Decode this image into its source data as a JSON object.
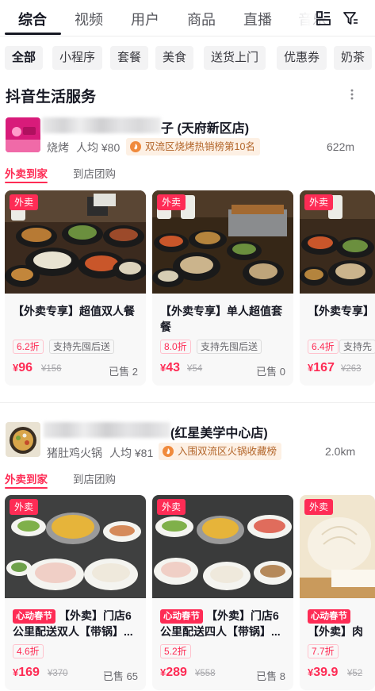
{
  "top_tabs": [
    "综合",
    "视频",
    "用户",
    "商品",
    "直播",
    "音乐"
  ],
  "top_icons": [
    "layout-icon",
    "filter-icon"
  ],
  "filter_chips": [
    "全部",
    "小程序",
    "套餐",
    "美食",
    "送货上门",
    "优惠券",
    "奶茶"
  ],
  "section_title": "抖音生活服务",
  "store1": {
    "name_suffix": "子 (天府新区店)",
    "category": "烧烤",
    "avg_price": "人均 ¥80",
    "rank": "双流区烧烤热销榜第10名",
    "distance": "622m",
    "tab_delivery": "外卖到家",
    "tab_groupbuy": "到店团购",
    "products": [
      {
        "tag": "外卖",
        "title": "【外卖专享】超值双人餐",
        "discount": "6.2折",
        "feature": "支持先囤后送",
        "price": "96",
        "orig": "¥156",
        "sold": "已售 2"
      },
      {
        "tag": "外卖",
        "title": "【外卖专享】单人超值套餐",
        "discount": "8.0折",
        "feature": "支持先囤后送",
        "price": "43",
        "orig": "¥54",
        "sold": "已售 0"
      },
      {
        "tag": "外卖",
        "title": "【外卖专享】",
        "discount": "6.4折",
        "feature": "支持先",
        "price": "167",
        "orig": "¥263",
        "sold": ""
      }
    ]
  },
  "store2": {
    "name_suffix": "(红星美学中心店)",
    "category": "猪肚鸡火锅",
    "avg_price": "人均 ¥81",
    "rank": "入围双流区火锅收藏榜",
    "distance": "2.0km",
    "tab_delivery": "外卖到家",
    "tab_groupbuy": "到店团购",
    "products": [
      {
        "tag": "外卖",
        "promo": "心动春节",
        "title": "【外卖】门店6公里配送双人【带锅】...",
        "discount": "4.6折",
        "price": "169",
        "orig": "¥370",
        "sold": "已售 65"
      },
      {
        "tag": "外卖",
        "promo": "心动春节",
        "title": "【外卖】门店6公里配送四人【带锅】...",
        "discount": "5.2折",
        "price": "289",
        "orig": "¥558",
        "sold": "已售 8"
      },
      {
        "tag": "外卖",
        "promo": "心动春节",
        "title": "【外卖】肉包",
        "discount": "7.7折",
        "price": "39.9",
        "orig": "¥52",
        "sold": ""
      }
    ]
  },
  "colors": {
    "accent": "#fe2c55",
    "rank_text": "#b3662b",
    "rank_bg": "#fdf0e4"
  }
}
